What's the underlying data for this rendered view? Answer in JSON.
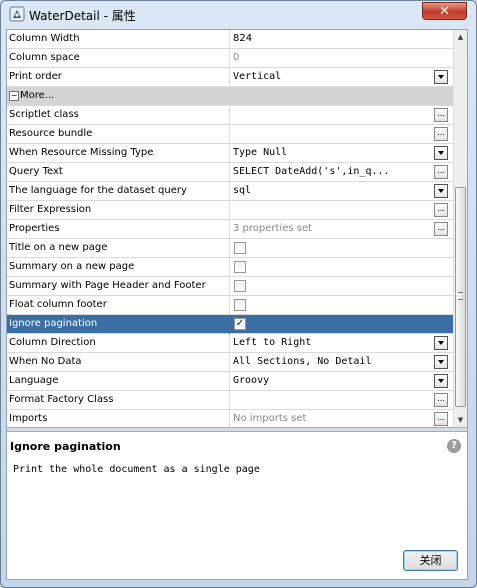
{
  "window": {
    "title": "WaterDetail - 属性",
    "close_glyph": "✕"
  },
  "properties": {
    "rows": [
      {
        "name": "Column Width",
        "value": "824",
        "value_style": "",
        "control": "none"
      },
      {
        "name": "Column space",
        "value": "0",
        "value_style": "gray",
        "control": "none"
      },
      {
        "name": "Print order",
        "value": "Vertical",
        "value_style": "mono",
        "control": "dropdown"
      },
      {
        "name": "More...",
        "value": "",
        "value_style": "",
        "control": "group",
        "expander": "−"
      },
      {
        "name": "Scriptlet class",
        "value": "",
        "value_style": "",
        "control": "dots"
      },
      {
        "name": "Resource bundle",
        "value": "",
        "value_style": "",
        "control": "dots"
      },
      {
        "name": "When Resource Missing Type",
        "value": "Type Null",
        "value_style": "mono",
        "control": "dropdown"
      },
      {
        "name": "Query Text",
        "value": "SELECT        DateAdd('s',in_q...",
        "value_style": "mono",
        "control": "dots"
      },
      {
        "name": "The language for the dataset query",
        "value": "sql",
        "value_style": "mono",
        "control": "dropdown"
      },
      {
        "name": "Filter Expression",
        "value": "",
        "value_style": "",
        "control": "dots"
      },
      {
        "name": "Properties",
        "value": "3 properties set",
        "value_style": "gray",
        "control": "dots"
      },
      {
        "name": "Title on a new page",
        "value": "",
        "value_style": "",
        "control": "checkbox",
        "checked": false
      },
      {
        "name": "Summary on a new page",
        "value": "",
        "value_style": "",
        "control": "checkbox",
        "checked": false
      },
      {
        "name": "Summary with Page Header and Footer",
        "value": "",
        "value_style": "",
        "control": "checkbox",
        "checked": false
      },
      {
        "name": "Float column footer",
        "value": "",
        "value_style": "",
        "control": "checkbox",
        "checked": false
      },
      {
        "name": "Ignore pagination",
        "value": "",
        "value_style": "",
        "control": "checkbox",
        "checked": true,
        "selected": true
      },
      {
        "name": "Column Direction",
        "value": "Left to Right",
        "value_style": "mono",
        "control": "dropdown"
      },
      {
        "name": "When No Data",
        "value": "All Sections, No Detail",
        "value_style": "mono",
        "control": "dropdown"
      },
      {
        "name": "Language",
        "value": "Groovy",
        "value_style": "mono",
        "control": "dropdown"
      },
      {
        "name": "Format Factory Class",
        "value": "",
        "value_style": "",
        "control": "dots"
      },
      {
        "name": "Imports",
        "value": "No imports set",
        "value_style": "gray",
        "control": "dots"
      }
    ],
    "dots_glyph": "...",
    "check_glyph": "✓",
    "scroll_up": "▲",
    "scroll_down": "▼"
  },
  "description": {
    "title": "Ignore pagination",
    "text": "Print the whole document as a single page",
    "help_glyph": "?"
  },
  "footer": {
    "close_label": "关闭"
  },
  "colors": {
    "selection": "#3a6ea5",
    "group_row": "#d4d4d4",
    "close_button": "#c0392b"
  }
}
